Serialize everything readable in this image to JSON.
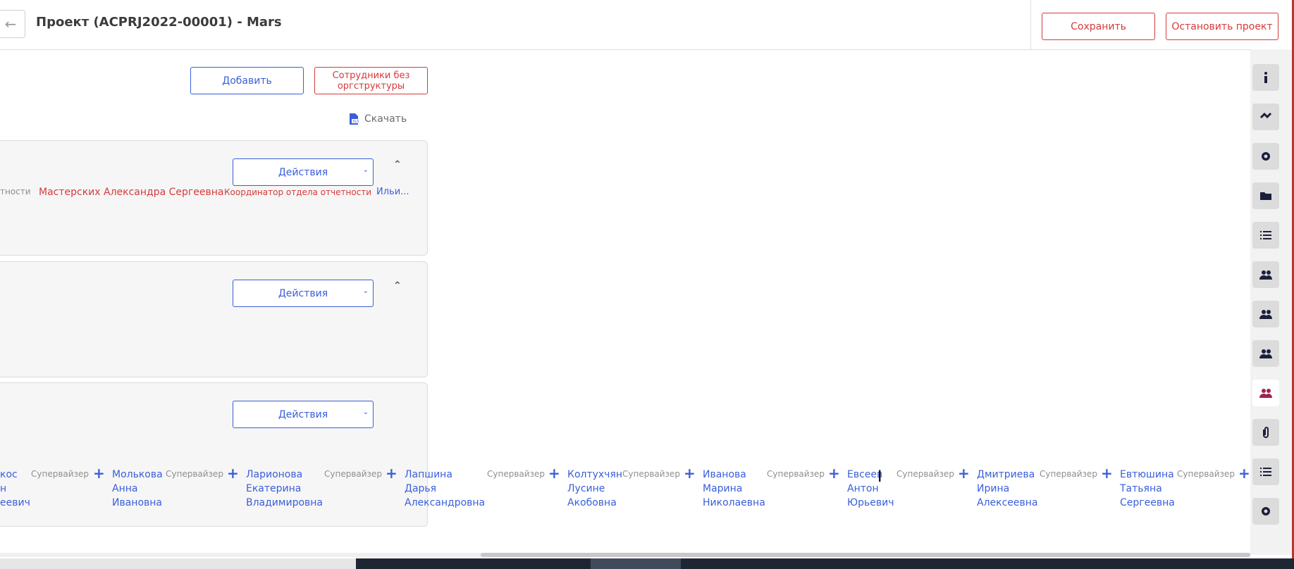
{
  "header": {
    "back_icon": "arrow-left-icon",
    "title": "Проект (ACPRJ2022-00001) - Mars",
    "save_label": "Сохранить",
    "stop_label": "Остановить проект"
  },
  "toolbar": {
    "add_label": "Добавить",
    "noorg_line1": "Сотрудники без",
    "noorg_line2": "оргструктуры",
    "download_label": "Скачать",
    "download_icon": "file-xls-icon"
  },
  "cards": [
    {
      "actions_label": "Действия",
      "row": {
        "role_fragment": "тности",
        "name": "Мастерских Александра Сергеевна",
        "role": "Координатор отдела отчетности",
        "trailing": "Ильи..."
      }
    },
    {
      "actions_label": "Действия"
    },
    {
      "actions_label": "Действия",
      "people": [
        {
          "last": "кос",
          "first": "н",
          "middle": "еевич",
          "role": "Супервайзер"
        },
        {
          "last": "Молькова",
          "first": "Анна",
          "middle": "Ивановна",
          "role": "Супервайзер"
        },
        {
          "last": "Ларионова",
          "first": "Екатерина",
          "middle": "Владимировна",
          "role": "Супервайзер"
        },
        {
          "last": "Лапшина",
          "first": "Дарья",
          "middle": "Александровна",
          "role": "Супервайзер"
        },
        {
          "last": "Колтухчян",
          "first": "Лусине",
          "middle": "Акобовна",
          "role": "Супервайзер"
        },
        {
          "last": "Иванова",
          "first": "Марина",
          "middle": "Николаевна",
          "role": "Супервайзер"
        },
        {
          "last": "Евсеев",
          "first": "Антон",
          "middle": "Юрьевич",
          "role": "Супервайзер"
        },
        {
          "last": "Дмитриева",
          "first": "Ирина",
          "middle": "Алексеевна",
          "role": "Супервайзер"
        },
        {
          "last": "Евтюшина",
          "first": "Татьяна",
          "middle": "Сергеевна",
          "role": "Супервайзер"
        }
      ]
    }
  ],
  "rail": [
    "info-icon",
    "handshake-icon",
    "gear-icon",
    "folder-icon",
    "list-icon",
    "users-icon",
    "users-icon",
    "users-icon",
    "users-active-icon",
    "paperclip-icon",
    "list-icon",
    "gear-icon"
  ],
  "colors": {
    "accent_blue": "#3a5fd9",
    "accent_red": "#d63a3a",
    "active_rail": "#a3224a"
  }
}
